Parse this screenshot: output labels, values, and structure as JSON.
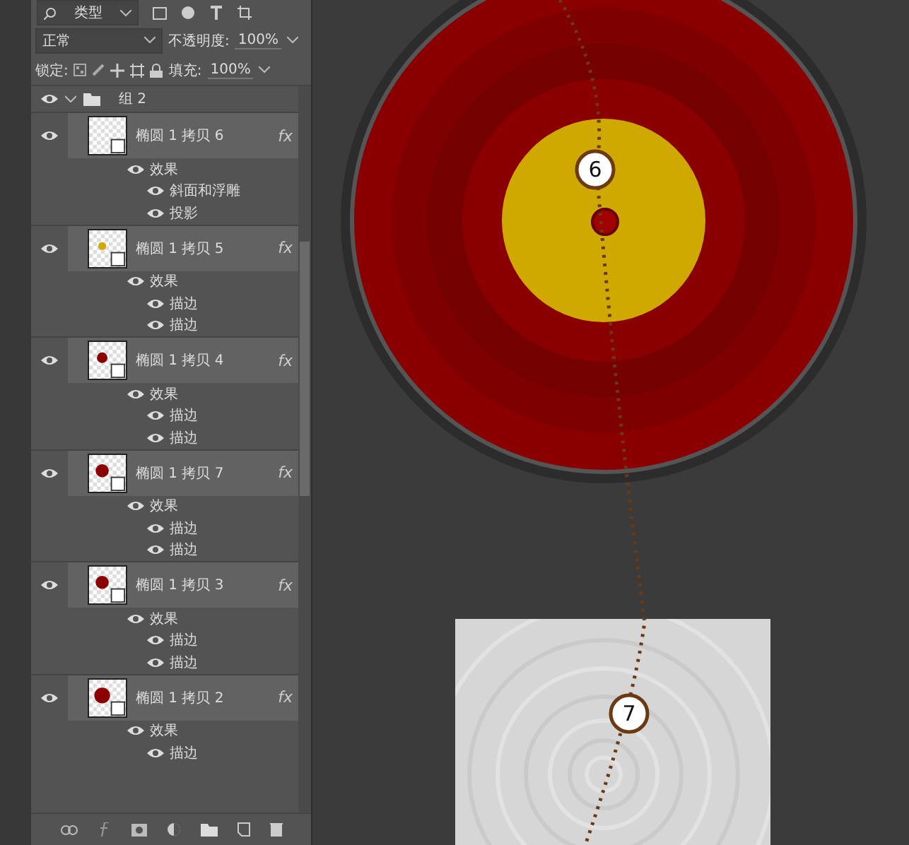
{
  "layers_panel": {
    "filter": {
      "label": "类型"
    },
    "blend_mode": {
      "value": "正常"
    },
    "opacity": {
      "label": "不透明度:",
      "value": "100%"
    },
    "lock": {
      "label": "锁定:"
    },
    "fill": {
      "label": "填充:",
      "value": "100%"
    },
    "group": {
      "name": "组 2",
      "expanded": true
    },
    "layers": [
      {
        "name": "椭圆 1 拷贝 6",
        "thumb": {
          "kind": "blank"
        },
        "fx": "fx",
        "effects_label": "效果",
        "effects": [
          "斜面和浮雕",
          "投影"
        ]
      },
      {
        "name": "椭圆 1 拷贝 5",
        "thumb": {
          "kind": "small",
          "color": "#d4a800"
        },
        "fx": "fx",
        "effects_label": "效果",
        "effects": [
          "描边",
          "描边"
        ]
      },
      {
        "name": "椭圆 1 拷贝 4",
        "thumb": {
          "kind": "medium",
          "color": "#8b0000"
        },
        "fx": "fx",
        "effects_label": "效果",
        "effects": [
          "描边",
          "描边"
        ]
      },
      {
        "name": "椭圆 1 拷贝 7",
        "thumb": {
          "kind": "large",
          "color": "#8b0000"
        },
        "fx": "fx",
        "effects_label": "效果",
        "effects": [
          "描边",
          "描边"
        ]
      },
      {
        "name": "椭圆 1 拷贝 3",
        "thumb": {
          "kind": "large",
          "color": "#8b0000"
        },
        "fx": "fx",
        "effects_label": "效果",
        "effects": [
          "描边",
          "描边"
        ]
      },
      {
        "name": "椭圆 1 拷贝 2",
        "thumb": {
          "kind": "huge",
          "color": "#8b0000"
        },
        "fx": "fx",
        "effects_label": "效果",
        "effects": [
          "描边"
        ]
      }
    ]
  },
  "canvas": {
    "markers": [
      {
        "label": "6"
      },
      {
        "label": "7"
      }
    ]
  }
}
